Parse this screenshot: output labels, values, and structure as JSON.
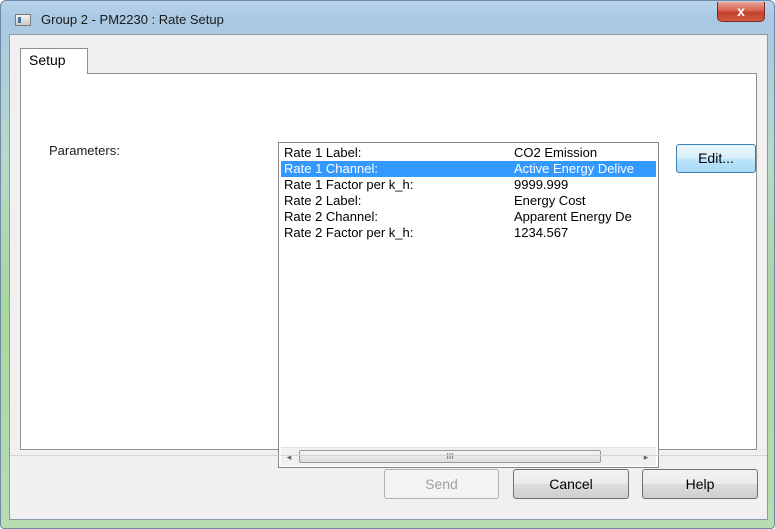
{
  "window": {
    "title": "Group 2 - PM2230 : Rate Setup",
    "close_label": "x"
  },
  "tabs": [
    {
      "label": "Setup",
      "selected": true
    }
  ],
  "setup": {
    "parameters_label": "Parameters:",
    "rows": [
      {
        "name": "Rate 1 Label:",
        "value": "CO2 Emission",
        "selected": false
      },
      {
        "name": "Rate 1 Channel:",
        "value": "Active Energy Delive",
        "selected": true
      },
      {
        "name": "Rate 1 Factor per k_h:",
        "value": "9999.999",
        "selected": false
      },
      {
        "name": "Rate 2 Label:",
        "value": "Energy Cost",
        "selected": false
      },
      {
        "name": "Rate 2 Channel:",
        "value": "Apparent Energy De",
        "selected": false
      },
      {
        "name": "Rate 2 Factor per k_h:",
        "value": "1234.567",
        "selected": false
      }
    ],
    "scrollbar": {
      "left_arrow": "◂",
      "right_arrow": "▸",
      "thumb_grip": "III"
    },
    "edit_label": "Edit..."
  },
  "footer": {
    "send_label": "Send",
    "send_enabled": false,
    "cancel_label": "Cancel",
    "help_label": "Help"
  },
  "colors": {
    "selection": "#3399ff",
    "close_button": "#c7432e"
  }
}
